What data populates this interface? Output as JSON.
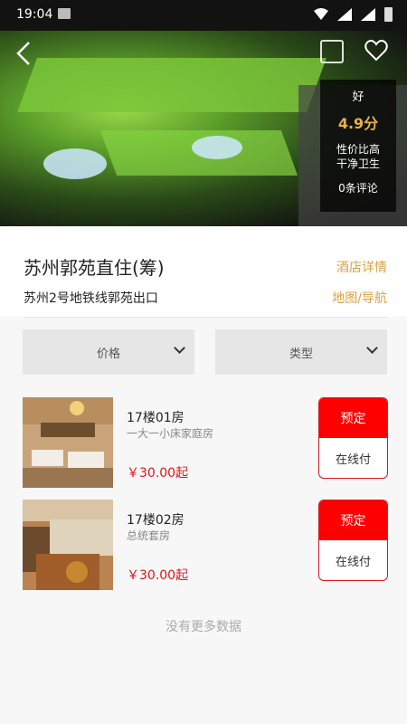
{
  "status_bar": {
    "time": "19:04"
  },
  "rating": {
    "level": "好",
    "score": "4.9分",
    "tag1": "性价比高",
    "tag2": "干净卫生",
    "reviews": "0条评论"
  },
  "hotel": {
    "name": "苏州郭苑直住(筹)",
    "detail_link": "酒店详情",
    "address": "苏州2号地铁线郭苑出口",
    "map_link": "地图/导航"
  },
  "filters": [
    {
      "label": "价格"
    },
    {
      "label": "类型"
    }
  ],
  "rooms": [
    {
      "title": "17楼01房",
      "type": "一大一小床家庭房",
      "price": "￥30.00起",
      "book_label": "预定",
      "pay_label": "在线付"
    },
    {
      "title": "17楼02房",
      "type": "总统套房",
      "price": "￥30.00起",
      "book_label": "预定",
      "pay_label": "在线付"
    }
  ],
  "footer": {
    "no_more": "没有更多数据"
  },
  "colors": {
    "accent_gold": "#d9a441",
    "book_red": "#ff0000",
    "price_red": "#d7191f"
  },
  "icons": [
    "back-arrow-icon",
    "share-icon",
    "heart-icon",
    "wifi-icon",
    "signal-icon",
    "battery-icon",
    "photo-icon",
    "chevron-down-icon"
  ]
}
